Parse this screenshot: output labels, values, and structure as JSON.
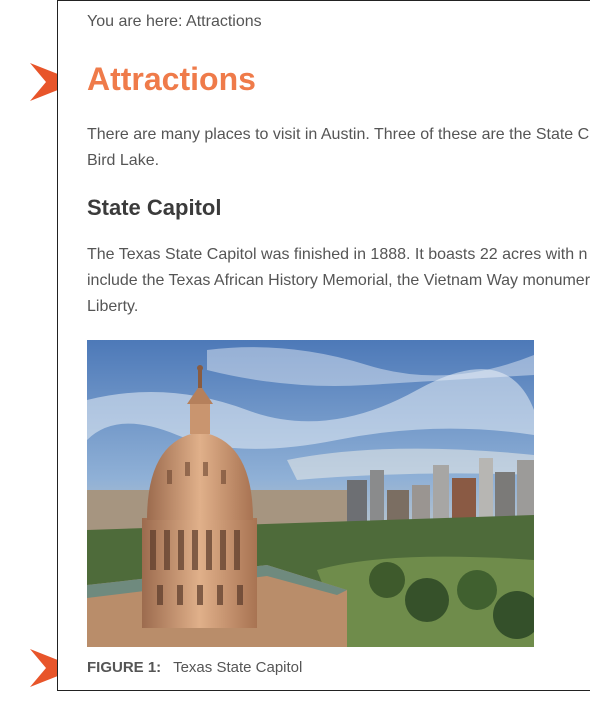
{
  "breadcrumb": {
    "label": "You are here:",
    "current": "Attractions"
  },
  "page": {
    "title": "Attractions"
  },
  "intro": {
    "line1": "There are many places to visit in Austin. Three of these are the State C",
    "line2": "Bird Lake."
  },
  "section": {
    "title": "State Capitol",
    "body_line1": "The Texas State Capitol was finished in 1888. It boasts 22 acres with n",
    "body_line2": "include the Texas African History Memorial, the Vietnam Way monumer",
    "body_line3": "Liberty."
  },
  "figure": {
    "label": "FIGURE 1:",
    "caption": "Texas State Capitol"
  },
  "colors": {
    "accent": "#ef7b4a",
    "arrow": "#e8552a"
  }
}
